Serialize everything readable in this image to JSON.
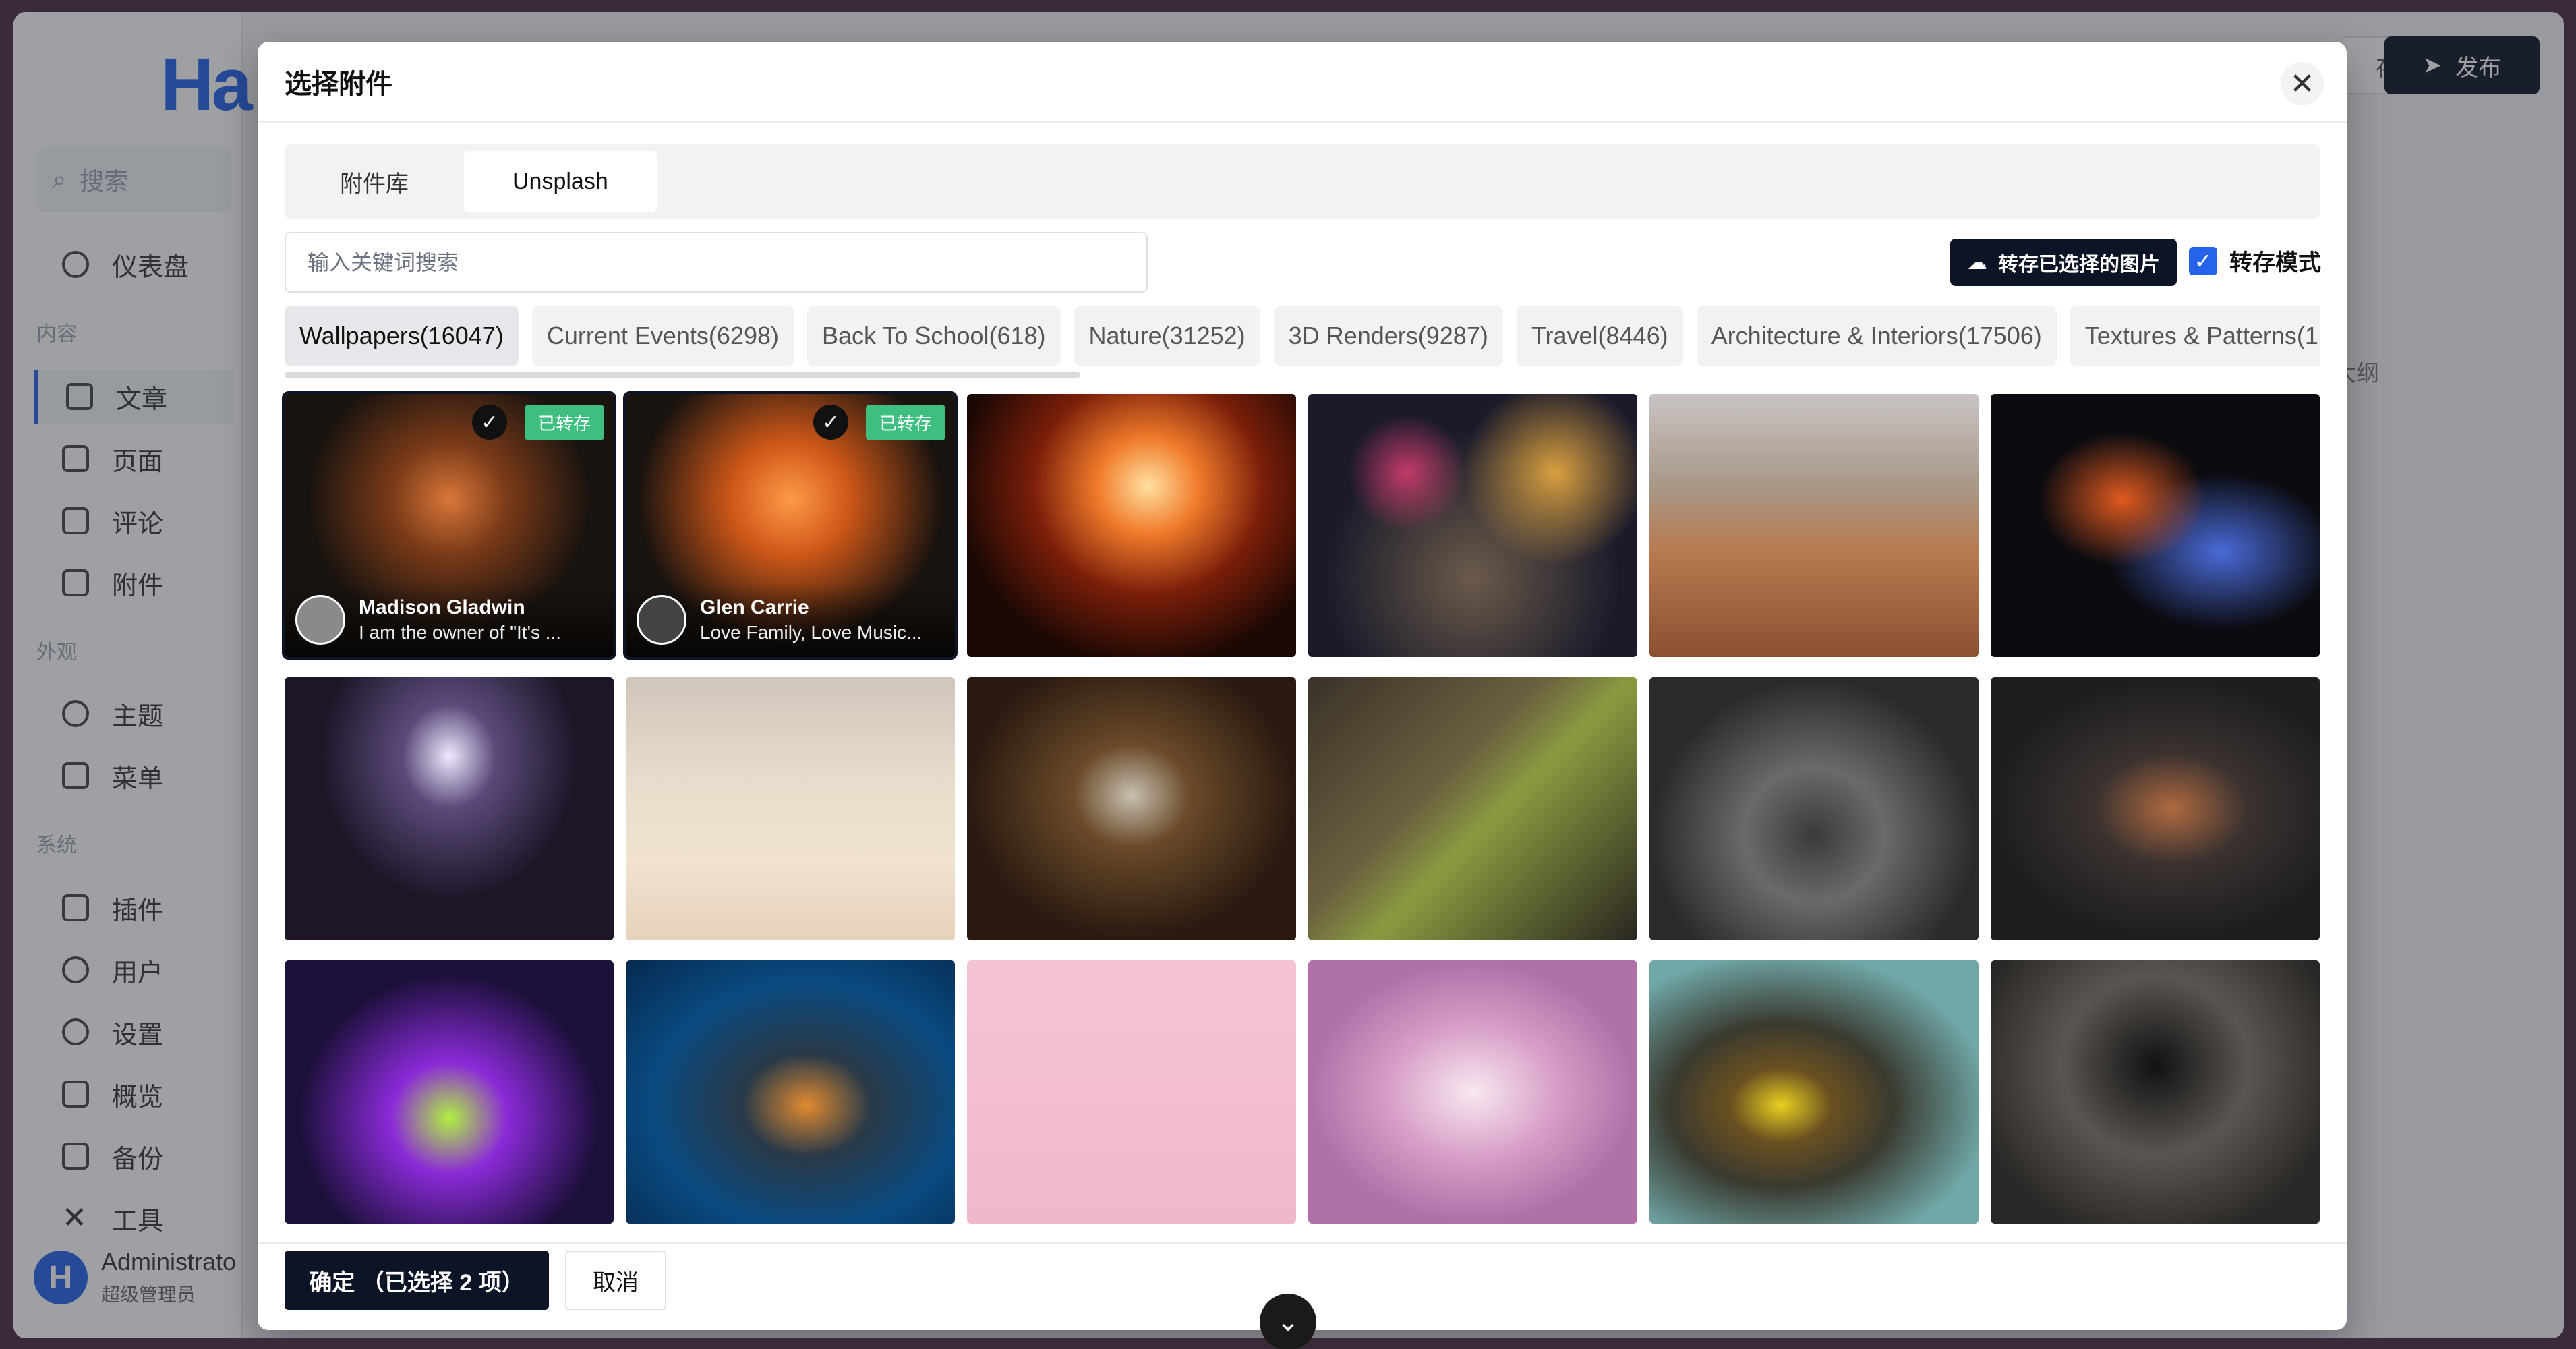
{
  "background": {
    "logo": "Ha",
    "search_placeholder": "搜索",
    "groups": {
      "content": "内容",
      "appearance": "外观",
      "system": "系统"
    },
    "nav": [
      {
        "label": "仪表盘",
        "icon": "dashboard-icon"
      },
      {
        "label": "文章",
        "icon": "article-icon"
      },
      {
        "label": "页面",
        "icon": "page-icon"
      },
      {
        "label": "评论",
        "icon": "comment-icon"
      },
      {
        "label": "附件",
        "icon": "folder-icon"
      },
      {
        "label": "主题",
        "icon": "palette-icon"
      },
      {
        "label": "菜单",
        "icon": "menu-icon"
      },
      {
        "label": "插件",
        "icon": "plugin-icon"
      },
      {
        "label": "用户",
        "icon": "user-icon"
      },
      {
        "label": "设置",
        "icon": "gear-icon"
      },
      {
        "label": "概览",
        "icon": "terminal-icon"
      },
      {
        "label": "备份",
        "icon": "backup-icon"
      },
      {
        "label": "工具",
        "icon": "tools-icon"
      }
    ],
    "user": {
      "avatar": "H",
      "name": "Administrato",
      "role": "超级管理员"
    },
    "topbar": {
      "save_partial": "存",
      "publish": "发布",
      "outline": "大纲"
    }
  },
  "modal": {
    "title": "选择附件",
    "tabs": [
      {
        "label": "附件库"
      },
      {
        "label": "Unsplash"
      }
    ],
    "search_placeholder": "输入关键词搜索",
    "save_selected_label": "转存已选择的图片",
    "save_mode_label": "转存模式",
    "save_mode_checked": true,
    "categories": [
      "Wallpapers(16047)",
      "Current Events(6298)",
      "Back To School(618)",
      "Nature(31252)",
      "3D Renders(9287)",
      "Travel(8446)",
      "Architecture & Interiors(17506)",
      "Textures & Patterns(1"
    ],
    "saved_badge": "已转存",
    "selected_photos": [
      {
        "name": "Madison Gladwin",
        "bio": "I am the owner of \"It's ..."
      },
      {
        "name": "Glen Carrie",
        "bio": "Love Family, Love Music..."
      }
    ],
    "confirm_label": "确定 （已选择 2 项）",
    "cancel_label": "取消"
  },
  "colors": {
    "primary": "#0c1425",
    "accent_blue": "#2563eb",
    "saved_green": "#3fbf7f"
  }
}
